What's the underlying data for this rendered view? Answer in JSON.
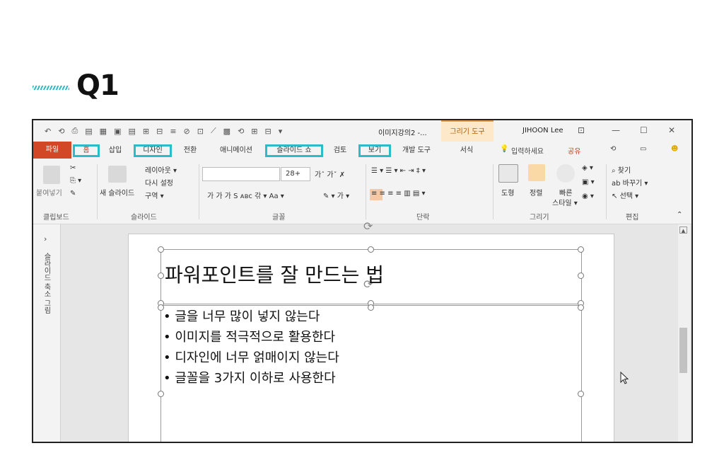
{
  "heading": {
    "label": "Q1"
  },
  "window": {
    "doc_title": "이미지강의2 -...",
    "tool_context": "그리기 도구",
    "user": "JIHOON Lee",
    "qat": [
      "↶",
      "⟲",
      "⎙",
      "▤",
      "▦",
      "▣",
      "▤",
      "⊞",
      "⊟",
      "≡",
      "⊘",
      "⊡",
      "⟋",
      "▩",
      "⟲",
      "⊞",
      "⊟",
      "▾"
    ],
    "controls": {
      "ribbon_opts": "⊡",
      "minimize": "—",
      "maximize": "☐",
      "close": "✕"
    }
  },
  "tabs": [
    {
      "label": "파일"
    },
    {
      "label": "홈"
    },
    {
      "label": "삽입"
    },
    {
      "label": "디자인"
    },
    {
      "label": "전환"
    },
    {
      "label": "애니메이션"
    },
    {
      "label": "슬라이드 쇼"
    },
    {
      "label": "검토"
    },
    {
      "label": "보기"
    },
    {
      "label": "개발 도구"
    },
    {
      "label": "서식"
    }
  ],
  "tab_right": {
    "search": "입력하세요",
    "share": "공유",
    "history": "⟲",
    "comment": "▭",
    "smile": "☻"
  },
  "ribbon": {
    "clipboard": {
      "paste": "붙여넣기",
      "group": "클립보드"
    },
    "slides": {
      "new_slide": "새 슬라이드",
      "layout": "레이아웃 ▾",
      "reset": "다시 설정",
      "section": "구역 ▾",
      "group": "슬라이드"
    },
    "font": {
      "size": "28+",
      "row2": "가  가  가  S  ᴀʙᴄ  갂  ▾  Aa  ▾",
      "group": "글꼴"
    },
    "paragraph": {
      "group": "단락"
    },
    "drawing": {
      "shapes": "도형",
      "arrange": "정렬",
      "quick1": "빠른",
      "quick2": "스타일 ▾",
      "group": "그리기"
    },
    "editing": {
      "find": "찾기",
      "replace": "바꾸기 ▾",
      "select": "선택 ▾",
      "group": "편집"
    }
  },
  "thumbpane": {
    "label": "슬라이드 축소 그림"
  },
  "slide": {
    "title": "파워포인트를 잘 만드는 법",
    "bullets": [
      "글을 너무 많이 넣지 않는다",
      "이미지를 적극적으로 활용한다",
      "디자인에 너무 얽매이지 않는다",
      "글꼴을 3가지 이하로 사용한다"
    ]
  },
  "colors": {
    "accent": "#2bbcc8",
    "file_tab": "#d24726",
    "tool_tab": "#fde9c9"
  }
}
